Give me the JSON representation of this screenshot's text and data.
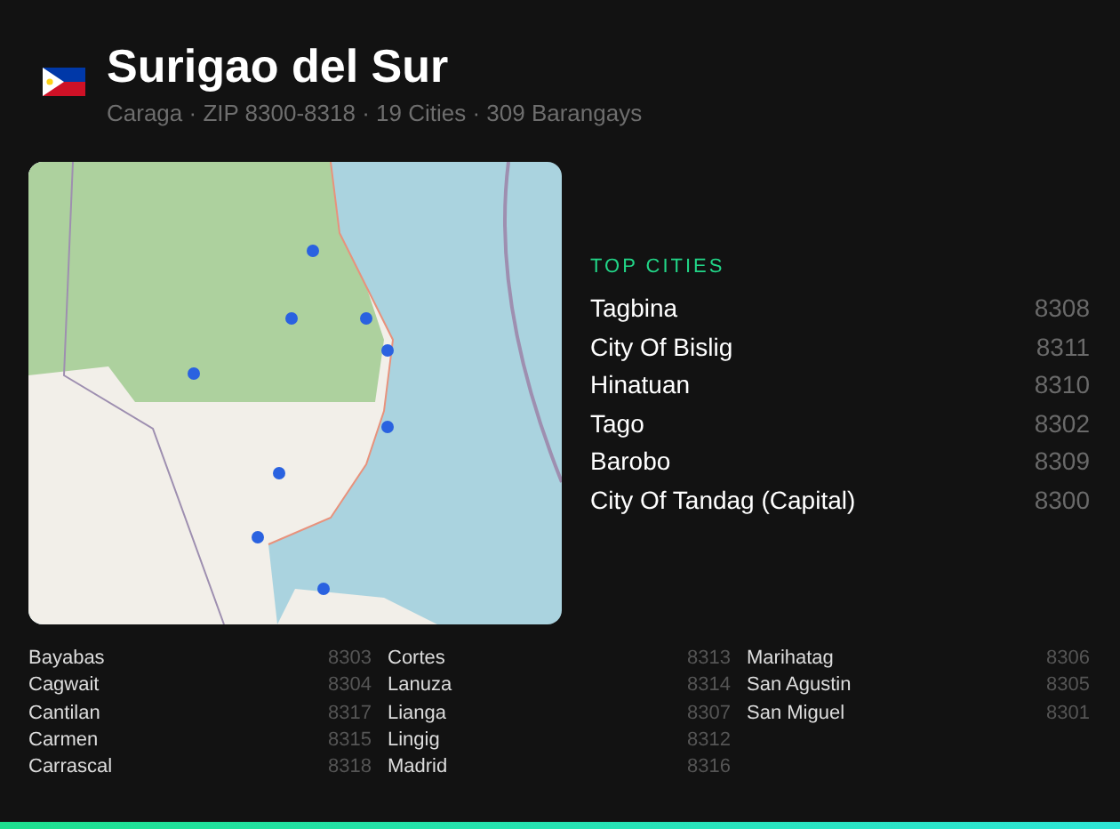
{
  "header": {
    "title": "Surigao del Sur",
    "subtitle": "Caraga · ZIP 8300-8318 · 19 Cities · 309 Barangays"
  },
  "top_cities": {
    "heading": "TOP CITIES",
    "items": [
      {
        "name": "Tagbina",
        "zip": "8308"
      },
      {
        "name": "City Of Bislig",
        "zip": "8311"
      },
      {
        "name": "Hinatuan",
        "zip": "8310"
      },
      {
        "name": "Tago",
        "zip": "8302"
      },
      {
        "name": "Barobo",
        "zip": "8309"
      },
      {
        "name": "City Of Tandag (Capital)",
        "zip": "8300"
      }
    ]
  },
  "all_cities": [
    {
      "name": "Bayabas",
      "zip": "8303"
    },
    {
      "name": "Cagwait",
      "zip": "8304"
    },
    {
      "name": "Cantilan",
      "zip": "8317"
    },
    {
      "name": "Carmen",
      "zip": "8315"
    },
    {
      "name": "Carrascal",
      "zip": "8318"
    },
    {
      "name": "Cortes",
      "zip": "8313"
    },
    {
      "name": "Lanuza",
      "zip": "8314"
    },
    {
      "name": "Lianga",
      "zip": "8307"
    },
    {
      "name": "Lingig",
      "zip": "8312"
    },
    {
      "name": "Madrid",
      "zip": "8316"
    },
    {
      "name": "Marihatag",
      "zip": "8306"
    },
    {
      "name": "San Agustin",
      "zip": "8305"
    },
    {
      "name": "San Miguel",
      "zip": "8301"
    }
  ]
}
